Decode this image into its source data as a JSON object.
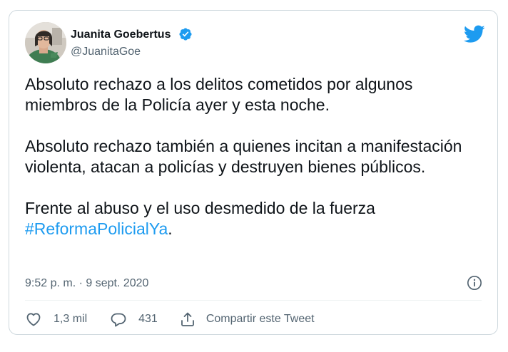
{
  "tweet": {
    "author_name": "Juanita Goebertus",
    "handle": "@JuanitaGoe",
    "paragraph_1": "Absoluto rechazo a los delitos cometidos por algunos miembros de la Policía ayer y esta noche.",
    "paragraph_2": "Absoluto rechazo también a quienes incitan a manifestación violenta, atacan a policías y destruyen bienes públicos.",
    "paragraph_3_text": "Frente al abuso y el uso desmedido de la fuerza",
    "hashtag": "#ReformaPolicialYa",
    "period": ".",
    "timestamp": "9:52 p. m. · 9 sept. 2020"
  },
  "actions": {
    "like_count": "1,3 mil",
    "reply_count": "431",
    "share_label": "Compartir este Tweet"
  },
  "icons": {
    "verified": "verified-badge-icon",
    "brand": "twitter-bird-icon",
    "info": "info-icon",
    "like": "heart-icon",
    "reply": "comment-bubble-icon",
    "share": "share-upload-icon"
  },
  "colors": {
    "accent": "#1d9bf0",
    "text": "#0f1419",
    "secondary_text": "#536471",
    "border": "#cfd9de"
  }
}
